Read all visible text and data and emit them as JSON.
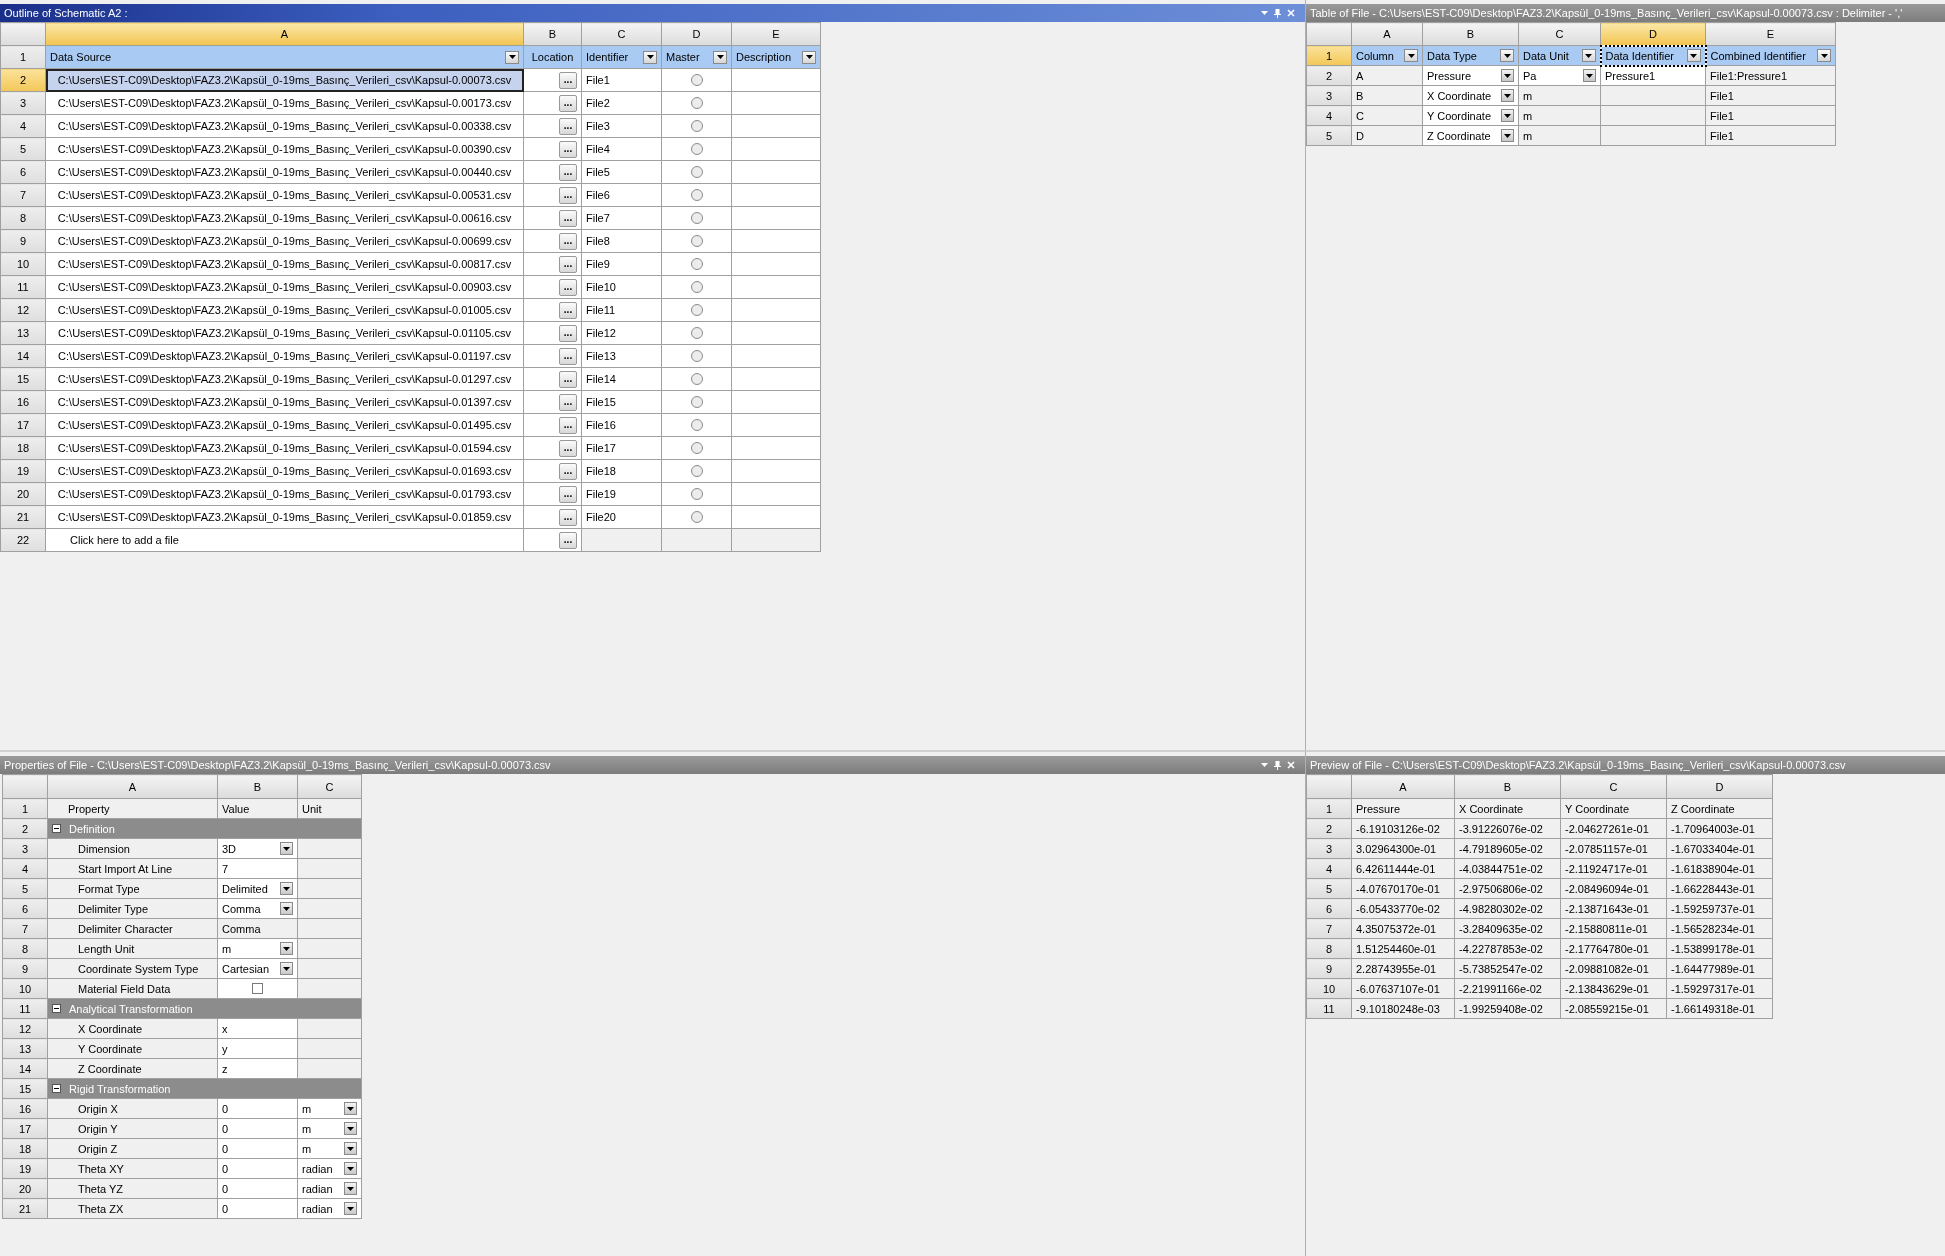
{
  "outline": {
    "title": "Outline of Schematic A2 :",
    "column_letters": [
      {
        "text": "A",
        "selected": true
      },
      {
        "text": "B",
        "selected": false
      },
      {
        "text": "C",
        "selected": false
      },
      {
        "text": "D",
        "selected": false
      },
      {
        "text": "E",
        "selected": false
      }
    ],
    "header": {
      "number": "1",
      "selected": false,
      "cells": [
        {
          "text": "Data Source",
          "filter": true
        },
        {
          "text": "Location",
          "filter": false
        },
        {
          "text": "Identifier",
          "filter": true
        },
        {
          "text": "Master",
          "filter": true
        },
        {
          "text": "Description",
          "filter": true
        }
      ]
    },
    "rows": [
      {
        "number": "2",
        "source": "C:\\Users\\EST-C09\\Desktop\\FAZ3.2\\Kapsül_0-19ms_Basınç_Verileri_csv\\Kapsul-0.00073.csv",
        "browse": "...",
        "identifier": "File1",
        "master": false,
        "selected": true
      },
      {
        "number": "3",
        "source": "C:\\Users\\EST-C09\\Desktop\\FAZ3.2\\Kapsül_0-19ms_Basınç_Verileri_csv\\Kapsul-0.00173.csv",
        "browse": "...",
        "identifier": "File2",
        "master": false,
        "selected": false
      },
      {
        "number": "4",
        "source": "C:\\Users\\EST-C09\\Desktop\\FAZ3.2\\Kapsül_0-19ms_Basınç_Verileri_csv\\Kapsul-0.00338.csv",
        "browse": "...",
        "identifier": "File3",
        "master": false,
        "selected": false
      },
      {
        "number": "5",
        "source": "C:\\Users\\EST-C09\\Desktop\\FAZ3.2\\Kapsül_0-19ms_Basınç_Verileri_csv\\Kapsul-0.00390.csv",
        "browse": "...",
        "identifier": "File4",
        "master": false,
        "selected": false
      },
      {
        "number": "6",
        "source": "C:\\Users\\EST-C09\\Desktop\\FAZ3.2\\Kapsül_0-19ms_Basınç_Verileri_csv\\Kapsul-0.00440.csv",
        "browse": "...",
        "identifier": "File5",
        "master": false,
        "selected": false
      },
      {
        "number": "7",
        "source": "C:\\Users\\EST-C09\\Desktop\\FAZ3.2\\Kapsül_0-19ms_Basınç_Verileri_csv\\Kapsul-0.00531.csv",
        "browse": "...",
        "identifier": "File6",
        "master": false,
        "selected": false
      },
      {
        "number": "8",
        "source": "C:\\Users\\EST-C09\\Desktop\\FAZ3.2\\Kapsül_0-19ms_Basınç_Verileri_csv\\Kapsul-0.00616.csv",
        "browse": "...",
        "identifier": "File7",
        "master": false,
        "selected": false
      },
      {
        "number": "9",
        "source": "C:\\Users\\EST-C09\\Desktop\\FAZ3.2\\Kapsül_0-19ms_Basınç_Verileri_csv\\Kapsul-0.00699.csv",
        "browse": "...",
        "identifier": "File8",
        "master": false,
        "selected": false
      },
      {
        "number": "10",
        "source": "C:\\Users\\EST-C09\\Desktop\\FAZ3.2\\Kapsül_0-19ms_Basınç_Verileri_csv\\Kapsul-0.00817.csv",
        "browse": "...",
        "identifier": "File9",
        "master": false,
        "selected": false
      },
      {
        "number": "11",
        "source": "C:\\Users\\EST-C09\\Desktop\\FAZ3.2\\Kapsül_0-19ms_Basınç_Verileri_csv\\Kapsul-0.00903.csv",
        "browse": "...",
        "identifier": "File10",
        "master": false,
        "selected": false
      },
      {
        "number": "12",
        "source": "C:\\Users\\EST-C09\\Desktop\\FAZ3.2\\Kapsül_0-19ms_Basınç_Verileri_csv\\Kapsul-0.01005.csv",
        "browse": "...",
        "identifier": "File11",
        "master": false,
        "selected": false
      },
      {
        "number": "13",
        "source": "C:\\Users\\EST-C09\\Desktop\\FAZ3.2\\Kapsül_0-19ms_Basınç_Verileri_csv\\Kapsul-0.01105.csv",
        "browse": "...",
        "identifier": "File12",
        "master": false,
        "selected": false
      },
      {
        "number": "14",
        "source": "C:\\Users\\EST-C09\\Desktop\\FAZ3.2\\Kapsül_0-19ms_Basınç_Verileri_csv\\Kapsul-0.01197.csv",
        "browse": "...",
        "identifier": "File13",
        "master": false,
        "selected": false
      },
      {
        "number": "15",
        "source": "C:\\Users\\EST-C09\\Desktop\\FAZ3.2\\Kapsül_0-19ms_Basınç_Verileri_csv\\Kapsul-0.01297.csv",
        "browse": "...",
        "identifier": "File14",
        "master": false,
        "selected": false
      },
      {
        "number": "16",
        "source": "C:\\Users\\EST-C09\\Desktop\\FAZ3.2\\Kapsül_0-19ms_Basınç_Verileri_csv\\Kapsul-0.01397.csv",
        "browse": "...",
        "identifier": "File15",
        "master": false,
        "selected": false
      },
      {
        "number": "17",
        "source": "C:\\Users\\EST-C09\\Desktop\\FAZ3.2\\Kapsül_0-19ms_Basınç_Verileri_csv\\Kapsul-0.01495.csv",
        "browse": "...",
        "identifier": "File16",
        "master": false,
        "selected": false
      },
      {
        "number": "18",
        "source": "C:\\Users\\EST-C09\\Desktop\\FAZ3.2\\Kapsül_0-19ms_Basınç_Verileri_csv\\Kapsul-0.01594.csv",
        "browse": "...",
        "identifier": "File17",
        "master": false,
        "selected": false
      },
      {
        "number": "19",
        "source": "C:\\Users\\EST-C09\\Desktop\\FAZ3.2\\Kapsül_0-19ms_Basınç_Verileri_csv\\Kapsul-0.01693.csv",
        "browse": "...",
        "identifier": "File18",
        "master": false,
        "selected": false
      },
      {
        "number": "20",
        "source": "C:\\Users\\EST-C09\\Desktop\\FAZ3.2\\Kapsül_0-19ms_Basınç_Verileri_csv\\Kapsul-0.01793.csv",
        "browse": "...",
        "identifier": "File19",
        "master": false,
        "selected": false
      },
      {
        "number": "21",
        "source": "C:\\Users\\EST-C09\\Desktop\\FAZ3.2\\Kapsül_0-19ms_Basınç_Verileri_csv\\Kapsul-0.01859.csv",
        "browse": "...",
        "identifier": "File20",
        "master": false,
        "selected": false
      }
    ],
    "add_row": {
      "number": "22",
      "text": "Click here to add a file",
      "browse": "..."
    }
  },
  "file_table": {
    "title": "Table of File - C:\\Users\\EST-C09\\Desktop\\FAZ3.2\\Kapsül_0-19ms_Basınç_Verileri_csv\\Kapsul-0.00073.csv : Delimiter - ','",
    "column_letters": [
      {
        "text": "A",
        "selected": false
      },
      {
        "text": "B",
        "selected": false
      },
      {
        "text": "C",
        "selected": false
      },
      {
        "text": "D",
        "selected": true
      },
      {
        "text": "E",
        "selected": false
      }
    ],
    "header": {
      "number": "1",
      "selected": true,
      "cells": [
        {
          "text": "Column",
          "filter": true,
          "focused": false
        },
        {
          "text": "Data Type",
          "filter": true,
          "focused": false
        },
        {
          "text": "Data Unit",
          "filter": true,
          "focused": false
        },
        {
          "text": "Data Identifier",
          "filter": true,
          "focused": true
        },
        {
          "text": "Combined Identifier",
          "filter": true,
          "focused": false
        }
      ]
    },
    "rows": [
      {
        "number": "2",
        "cells": [
          {
            "text": "A",
            "kind": "readonly"
          },
          {
            "text": "Pressure",
            "kind": "dropdown"
          },
          {
            "text": "Pa",
            "kind": "dropdown"
          },
          {
            "text": "Pressure1",
            "kind": "edit"
          },
          {
            "text": "File1:Pressure1",
            "kind": "readonly"
          }
        ]
      },
      {
        "number": "3",
        "cells": [
          {
            "text": "B",
            "kind": "readonly"
          },
          {
            "text": "X Coordinate",
            "kind": "dropdown"
          },
          {
            "text": "m",
            "kind": "readonly"
          },
          {
            "kind": "readonly"
          },
          {
            "text": "File1",
            "kind": "readonly"
          }
        ]
      },
      {
        "number": "4",
        "cells": [
          {
            "text": "C",
            "kind": "readonly"
          },
          {
            "text": "Y Coordinate",
            "kind": "dropdown"
          },
          {
            "text": "m",
            "kind": "readonly"
          },
          {
            "kind": "readonly"
          },
          {
            "text": "File1",
            "kind": "readonly"
          }
        ]
      },
      {
        "number": "5",
        "cells": [
          {
            "text": "D",
            "kind": "readonly"
          },
          {
            "text": "Z Coordinate",
            "kind": "dropdown"
          },
          {
            "text": "m",
            "kind": "readonly"
          },
          {
            "kind": "readonly"
          },
          {
            "text": "File1",
            "kind": "readonly"
          }
        ]
      }
    ]
  },
  "properties": {
    "title": "Properties of File - C:\\Users\\EST-C09\\Desktop\\FAZ3.2\\Kapsül_0-19ms_Basınç_Verileri_csv\\Kapsul-0.00073.csv",
    "column_letters": [
      {
        "text": "A",
        "selected": false
      },
      {
        "text": "B",
        "selected": false
      },
      {
        "text": "C",
        "selected": false
      }
    ],
    "rows": [
      {
        "number": "1",
        "kind": "header",
        "cells": [
          "Property",
          "Value",
          "Unit"
        ]
      },
      {
        "number": "2",
        "kind": "group",
        "label": "Definition",
        "expanded": true
      },
      {
        "number": "3",
        "kind": "property",
        "name": "Dimension",
        "value": {
          "text": "3D",
          "kind": "dropdown"
        },
        "unit": {
          "kind": "readonly"
        }
      },
      {
        "number": "4",
        "kind": "property",
        "name": "Start Import At Line",
        "value": {
          "text": "7",
          "kind": "edit"
        },
        "unit": {
          "kind": "readonly"
        }
      },
      {
        "number": "5",
        "kind": "property",
        "name": "Format Type",
        "value": {
          "text": "Delimited",
          "kind": "dropdown"
        },
        "unit": {
          "kind": "readonly"
        }
      },
      {
        "number": "6",
        "kind": "property",
        "name": "Delimiter Type",
        "value": {
          "text": "Comma",
          "kind": "dropdown"
        },
        "unit": {
          "kind": "readonly"
        }
      },
      {
        "number": "7",
        "kind": "property",
        "name": "Delimiter Character",
        "value": {
          "text": "Comma",
          "kind": "readonly"
        },
        "unit": {
          "kind": "readonly"
        }
      },
      {
        "number": "8",
        "kind": "property",
        "name": "Length Unit",
        "value": {
          "text": "m",
          "kind": "dropdown"
        },
        "unit": {
          "kind": "readonly"
        }
      },
      {
        "number": "9",
        "kind": "property",
        "name": "Coordinate System Type",
        "value": {
          "text": "Cartesian",
          "kind": "dropdown"
        },
        "unit": {
          "kind": "readonly"
        }
      },
      {
        "number": "10",
        "kind": "property",
        "name": "Material Field Data",
        "value": {
          "kind": "checkbox",
          "checked": false
        },
        "unit": {
          "kind": "readonly"
        }
      },
      {
        "number": "11",
        "kind": "group",
        "label": "Analytical Transformation",
        "expanded": true
      },
      {
        "number": "12",
        "kind": "property",
        "name": "X Coordinate",
        "value": {
          "text": "x",
          "kind": "edit"
        },
        "unit": {
          "kind": "readonly"
        }
      },
      {
        "number": "13",
        "kind": "property",
        "name": "Y Coordinate",
        "value": {
          "text": "y",
          "kind": "edit"
        },
        "unit": {
          "kind": "readonly"
        }
      },
      {
        "number": "14",
        "kind": "property",
        "name": "Z Coordinate",
        "value": {
          "text": "z",
          "kind": "edit"
        },
        "unit": {
          "kind": "readonly"
        }
      },
      {
        "number": "15",
        "kind": "group",
        "label": "Rigid Transformation",
        "expanded": true
      },
      {
        "number": "16",
        "kind": "property",
        "name": "Origin X",
        "value": {
          "text": "0",
          "kind": "edit"
        },
        "unit": {
          "text": "m",
          "kind": "dropdown"
        }
      },
      {
        "number": "17",
        "kind": "property",
        "name": "Origin Y",
        "value": {
          "text": "0",
          "kind": "edit"
        },
        "unit": {
          "text": "m",
          "kind": "dropdown"
        }
      },
      {
        "number": "18",
        "kind": "property",
        "name": "Origin Z",
        "value": {
          "text": "0",
          "kind": "edit"
        },
        "unit": {
          "text": "m",
          "kind": "dropdown"
        }
      },
      {
        "number": "19",
        "kind": "property",
        "name": "Theta XY",
        "value": {
          "text": "0",
          "kind": "edit"
        },
        "unit": {
          "text": "radian",
          "kind": "dropdown"
        }
      },
      {
        "number": "20",
        "kind": "property",
        "name": "Theta YZ",
        "value": {
          "text": "0",
          "kind": "edit"
        },
        "unit": {
          "text": "radian",
          "kind": "dropdown"
        }
      },
      {
        "number": "21",
        "kind": "property",
        "name": "Theta ZX",
        "value": {
          "text": "0",
          "kind": "edit"
        },
        "unit": {
          "text": "radian",
          "kind": "dropdown"
        }
      }
    ]
  },
  "preview": {
    "title": "Preview of File - C:\\Users\\EST-C09\\Desktop\\FAZ3.2\\Kapsül_0-19ms_Basınç_Verileri_csv\\Kapsul-0.00073.csv",
    "column_letters": [
      {
        "text": "A",
        "selected": false
      },
      {
        "text": "B",
        "selected": false
      },
      {
        "text": "C",
        "selected": false
      },
      {
        "text": "D",
        "selected": false
      }
    ],
    "rows": [
      {
        "number": "1",
        "cells": [
          "Pressure",
          "X Coordinate",
          "Y Coordinate",
          "Z Coordinate"
        ]
      },
      {
        "number": "2",
        "cells": [
          "-6.19103126e-02",
          "-3.91226076e-02",
          "-2.04627261e-01",
          "-1.70964003e-01"
        ]
      },
      {
        "number": "3",
        "cells": [
          "3.02964300e-01",
          "-4.79189605e-02",
          "-2.07851157e-01",
          "-1.67033404e-01"
        ]
      },
      {
        "number": "4",
        "cells": [
          "6.42611444e-01",
          "-4.03844751e-02",
          "-2.11924717e-01",
          "-1.61838904e-01"
        ]
      },
      {
        "number": "5",
        "cells": [
          "-4.07670170e-01",
          "-2.97506806e-02",
          "-2.08496094e-01",
          "-1.66228443e-01"
        ]
      },
      {
        "number": "6",
        "cells": [
          "-6.05433770e-02",
          "-4.98280302e-02",
          "-2.13871643e-01",
          "-1.59259737e-01"
        ]
      },
      {
        "number": "7",
        "cells": [
          "4.35075372e-01",
          "-3.28409635e-02",
          "-2.15880811e-01",
          "-1.56528234e-01"
        ]
      },
      {
        "number": "8",
        "cells": [
          "1.51254460e-01",
          "-4.22787853e-02",
          "-2.17764780e-01",
          "-1.53899178e-01"
        ]
      },
      {
        "number": "9",
        "cells": [
          "2.28743955e-01",
          "-5.73852547e-02",
          "-2.09881082e-01",
          "-1.64477989e-01"
        ]
      },
      {
        "number": "10",
        "cells": [
          "-6.07637107e-01",
          "-2.21991166e-02",
          "-2.13843629e-01",
          "-1.59297317e-01"
        ]
      },
      {
        "number": "11",
        "cells": [
          "-9.10180248e-03",
          "-1.99259408e-02",
          "-2.08559215e-01",
          "-1.66149318e-01"
        ]
      }
    ]
  }
}
